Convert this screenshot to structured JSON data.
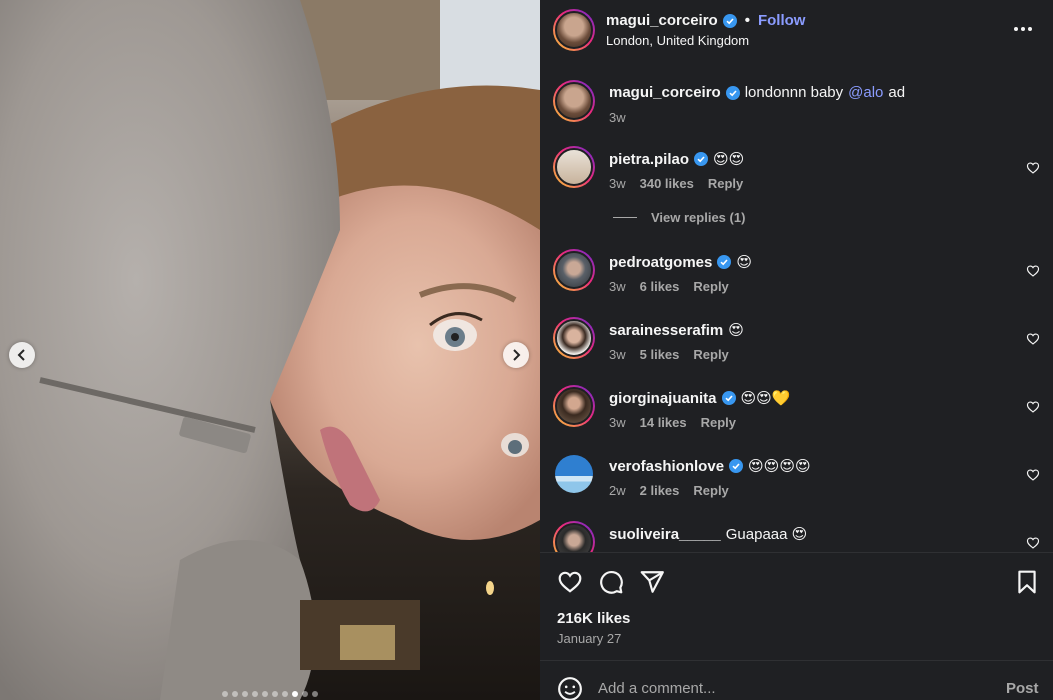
{
  "post": {
    "author": "magui_corceiro",
    "follow_label": "Follow",
    "separator": "•",
    "location": "London, United Kingdom",
    "more_icon": "more-options-icon",
    "carousel": {
      "total_slides": 10,
      "active_slide": 8
    }
  },
  "caption": {
    "username": "magui_corceiro",
    "text_before": "londonnn baby",
    "mention": "@alo",
    "text_after": "ad",
    "time": "3w"
  },
  "comments": [
    {
      "username": "pietra.pilao",
      "verified": true,
      "text": "😍😍",
      "time": "3w",
      "likes": "340 likes",
      "reply": "Reply",
      "avatar_color": "#d9c9b5"
    },
    {
      "username": "pedroatgomes",
      "verified": true,
      "text": "😍",
      "time": "3w",
      "likes": "6 likes",
      "reply": "Reply",
      "avatar_color": "#5a6068"
    },
    {
      "username": "sarainesserafim",
      "verified": false,
      "text": "😍",
      "time": "3w",
      "likes": "5 likes",
      "reply": "Reply",
      "avatar_color": "#e8e4df"
    },
    {
      "username": "giorginajuanita",
      "verified": true,
      "text": "😍😍💛",
      "time": "3w",
      "likes": "14 likes",
      "reply": "Reply",
      "avatar_color": "#5b4636"
    },
    {
      "username": "verofashionlove",
      "verified": true,
      "text": "😍😍😍😍",
      "time": "2w",
      "likes": "2 likes",
      "reply": "Reply",
      "avatar_color": "#3b8fd1"
    },
    {
      "username": "suoliveira_____",
      "verified": false,
      "text": "Guapaaa 😍",
      "time": "",
      "likes": "",
      "reply": "",
      "avatar_color": "#3a3a3a"
    }
  ],
  "view_replies": "View replies (1)",
  "stats": {
    "likes": "216K likes",
    "date": "January 27"
  },
  "composer": {
    "placeholder": "Add a comment...",
    "post_label": "Post"
  },
  "colors": {
    "accent": "#8b9cff",
    "verified": "#3897f0",
    "panel_bg": "#1f2023"
  }
}
